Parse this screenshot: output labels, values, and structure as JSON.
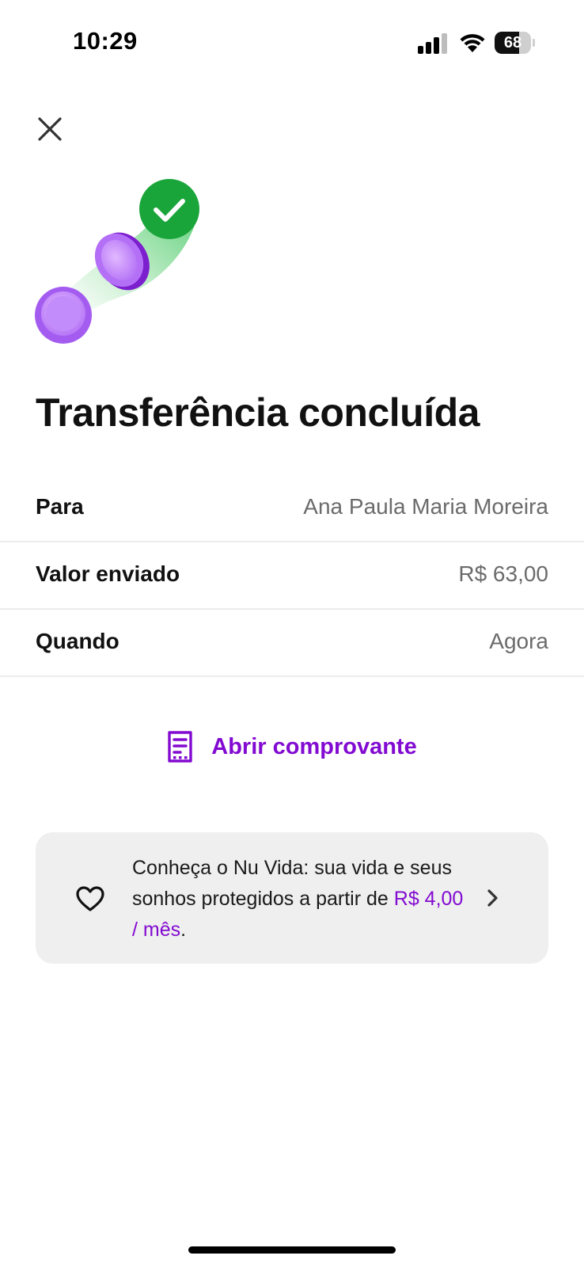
{
  "status_bar": {
    "time": "10:29",
    "battery_level": "68",
    "battery_fraction": 0.68,
    "icons": [
      "signal-icon",
      "wifi-icon",
      "battery-icon"
    ]
  },
  "header": {
    "close_icon": "close-icon"
  },
  "illustration": {
    "icons": [
      "coin-icon",
      "check-icon"
    ],
    "colors": {
      "coin": "#a855f7",
      "check_circle": "#1aa53a",
      "trail": "#7fd98f"
    }
  },
  "title": "Transferência concluída",
  "details": [
    {
      "label": "Para",
      "value": "Ana Paula Maria Moreira"
    },
    {
      "label": "Valor enviado",
      "value": "R$ 63,00"
    },
    {
      "label": "Quando",
      "value": "Agora"
    }
  ],
  "receipt": {
    "label": "Abrir comprovante",
    "icon": "receipt-icon"
  },
  "promo": {
    "text_before": "Conheça o Nu Vida: sua vida e seus sonhos protegidos a partir de ",
    "price": "R$ 4,00 / mês",
    "text_after": ".",
    "icon": "heart-icon",
    "chevron": "chevron-right-icon"
  },
  "colors": {
    "brand": "#820ad1",
    "text": "#111111",
    "muted": "#6b6b6b",
    "divider": "#ececec",
    "card_bg": "#efefef"
  }
}
